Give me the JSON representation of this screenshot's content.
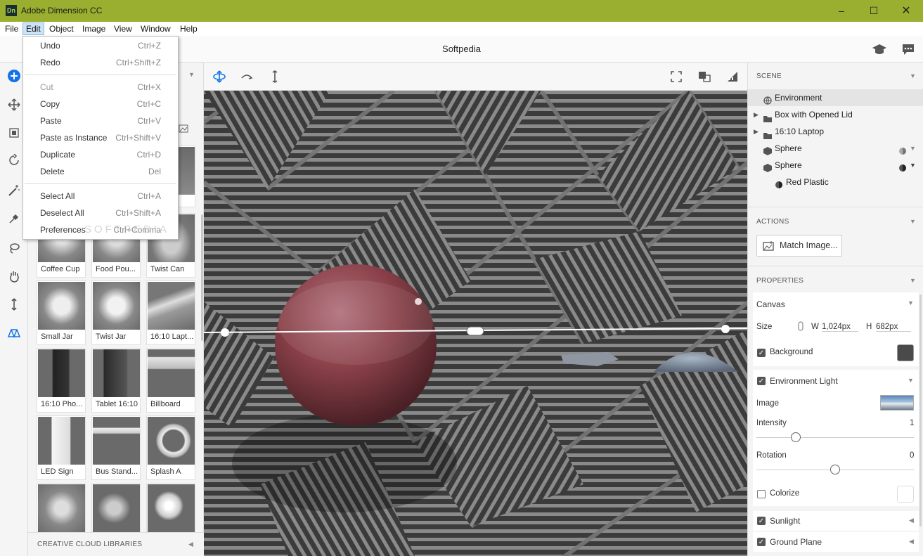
{
  "app": {
    "title": "Adobe Dimension CC",
    "logo": "Dn"
  },
  "menus": [
    "File",
    "Edit",
    "Object",
    "Image",
    "View",
    "Window",
    "Help"
  ],
  "active_menu": "Edit",
  "document_title": "Softpedia",
  "edit_menu": {
    "group1": [
      {
        "label": "Undo",
        "shortcut": "Ctrl+Z"
      },
      {
        "label": "Redo",
        "shortcut": "Ctrl+Shift+Z"
      }
    ],
    "group2": [
      {
        "label": "Cut",
        "shortcut": "Ctrl+X",
        "disabled": true
      },
      {
        "label": "Copy",
        "shortcut": "Ctrl+C"
      },
      {
        "label": "Paste",
        "shortcut": "Ctrl+V"
      },
      {
        "label": "Paste as Instance",
        "shortcut": "Ctrl+Shift+V"
      },
      {
        "label": "Duplicate",
        "shortcut": "Ctrl+D"
      },
      {
        "label": "Delete",
        "shortcut": "Del"
      }
    ],
    "group3": [
      {
        "label": "Select All",
        "shortcut": "Ctrl+A"
      },
      {
        "label": "Deselect All",
        "shortcut": "Ctrl+Shift+A"
      },
      {
        "label": "Preferences",
        "shortcut": "Ctrl+Comma"
      }
    ]
  },
  "assets": {
    "rows": [
      [
        "Coffee Cup",
        "Food Pou...",
        "Twist Can"
      ],
      [
        "Small Jar",
        "Twist Jar",
        "16:10 Lapt..."
      ],
      [
        "16:10 Pho...",
        "Tablet 16:10",
        "Billboard"
      ],
      [
        "LED Sign",
        "Bus Stand...",
        "Splash A"
      ],
      [
        "",
        "",
        ""
      ]
    ],
    "footer": "CREATIVE CLOUD LIBRARIES"
  },
  "scene": {
    "header": "SCENE",
    "items": [
      "Environment",
      "Box with Opened Lid",
      "16:10 Laptop",
      "Sphere",
      "Sphere",
      "Red Plastic"
    ]
  },
  "actions": {
    "header": "ACTIONS",
    "match_image": "Match Image..."
  },
  "properties": {
    "header": "PROPERTIES",
    "canvas": "Canvas",
    "size_label": "Size",
    "w_label": "W",
    "w_value": "1,024px",
    "h_label": "H",
    "h_value": "682px",
    "background": "Background",
    "background_checked": true,
    "background_color": "#4a4a4a",
    "env_light": "Environment Light",
    "env_light_checked": true,
    "image_label": "Image",
    "intensity_label": "Intensity",
    "intensity_value": "1",
    "intensity_fraction": 0.25,
    "rotation_label": "Rotation",
    "rotation_value": "0",
    "rotation_fraction": 0.5,
    "colorize": "Colorize",
    "colorize_checked": false,
    "sunlight": "Sunlight",
    "sunlight_checked": true,
    "ground_plane": "Ground Plane",
    "ground_plane_checked": true
  },
  "watermark": "SOFTPEDIA"
}
